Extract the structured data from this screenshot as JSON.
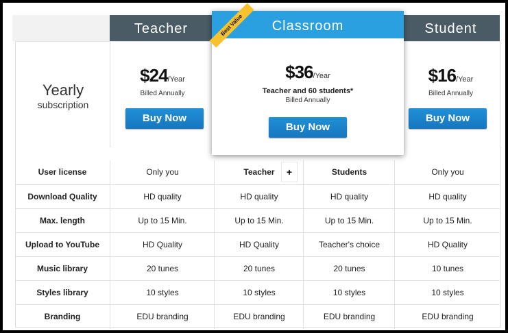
{
  "header": {
    "teacher_tab": "Teacher",
    "classroom_tab": "Classroom",
    "student_tab": "Student",
    "ribbon": "Best Value"
  },
  "subscription": {
    "title": "Yearly",
    "subtitle": "subscription"
  },
  "plans": {
    "teacher": {
      "price": "$24",
      "per": "/Year",
      "billed": "Billed Annually",
      "button": "Buy Now"
    },
    "classroom": {
      "price": "$36",
      "per": "/Year",
      "extra": "Teacher and 60 students*",
      "billed": "Billed Annually",
      "button": "Buy Now"
    },
    "student": {
      "price": "$16",
      "per": "/Year",
      "billed": "Billed Annually",
      "button": "Buy Now"
    }
  },
  "plus_sign": "+",
  "features": [
    {
      "label": "User license",
      "teacher": "Only you",
      "class_teacher": "Teacher",
      "class_students": "Students",
      "student": "Only you"
    },
    {
      "label": "Download Quality",
      "teacher": "HD quality",
      "class_teacher": "HD quality",
      "class_students": "HD quality",
      "student": "HD quality"
    },
    {
      "label": "Max. length",
      "teacher": "Up to 15 Min.",
      "class_teacher": "Up to 15 Min.",
      "class_students": "Up to 15 Min.",
      "student": "Up to 15 Min."
    },
    {
      "label": "Upload to YouTube",
      "teacher": "HD Quality",
      "class_teacher": "HD Quality",
      "class_students": "Teacher's choice",
      "student": "HD Quality"
    },
    {
      "label": "Music library",
      "teacher": "20 tunes",
      "class_teacher": "20 tunes",
      "class_students": "20 tunes",
      "student": "10 tunes"
    },
    {
      "label": "Styles library",
      "teacher": "10 styles",
      "class_teacher": "10 styles",
      "class_students": "10 styles",
      "student": "10 styles"
    },
    {
      "label": "Branding",
      "teacher": "EDU branding",
      "class_teacher": "EDU branding",
      "class_students": "EDU branding",
      "student": "EDU branding"
    }
  ],
  "colors": {
    "header_dark": "#4a5b66",
    "header_accent": "#2aa0e0",
    "button": "#1a82c8",
    "ribbon": "#f7c22e"
  }
}
